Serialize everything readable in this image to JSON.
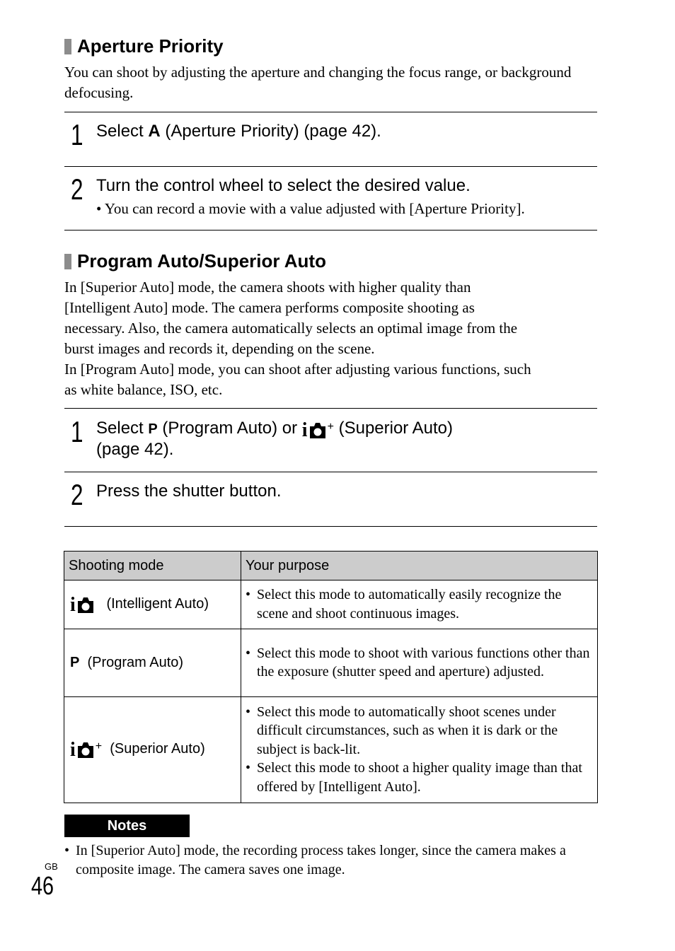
{
  "section1": {
    "title": "Aperture Priority",
    "intro": "You can shoot by adjusting the aperture and changing the focus range, or background defocusing.",
    "steps": [
      {
        "number": "1",
        "text_before": "Select ",
        "glyph": "A",
        "text_after": " (Aperture Priority) (page 42)."
      },
      {
        "number": "2",
        "text": "Turn the control wheel to select the desired value.",
        "sub": "• You can record a movie with a value adjusted with [Aperture Priority]."
      }
    ]
  },
  "section2": {
    "title": "Program Auto/Superior Auto",
    "intro_lines": [
      "In [Superior Auto] mode, the camera shoots with higher quality than",
      "[Intelligent Auto] mode. The camera performs composite shooting as",
      "necessary. Also, the camera automatically selects an optimal image from the",
      "burst images and records it, depending on the scene.",
      "In [Program Auto] mode, you can shoot after adjusting various functions, such",
      "as white balance, ISO, etc."
    ],
    "steps": [
      {
        "number": "1",
        "text_a": "Select ",
        "glyph": "P",
        "text_b": " (Program Auto) or ",
        "icon": "superior-auto-icon",
        "text_c": " (Superior Auto)",
        "text_d": "(page 42)."
      },
      {
        "number": "2",
        "text": "Press the shutter button."
      }
    ]
  },
  "table": {
    "headers": [
      "Shooting mode",
      "Your purpose"
    ],
    "rows": [
      {
        "icon": "intelligent-auto-icon",
        "mode": "(Intelligent Auto)",
        "purpose": [
          "Select this mode to automatically easily recognize the scene and shoot continuous images."
        ]
      },
      {
        "icon": "program-auto-icon",
        "glyph": "P",
        "mode": "(Program Auto)",
        "purpose": [
          "Select this mode to shoot with various functions other than the exposure (shutter speed and aperture) adjusted."
        ]
      },
      {
        "icon": "superior-auto-icon",
        "mode": "(Superior Auto)",
        "purpose": [
          "Select this mode to automatically shoot scenes under difficult circumstances, such as when it is dark or the subject is back-lit.",
          "Select this mode to shoot a higher quality image than that offered by [Intelligent Auto]."
        ]
      }
    ]
  },
  "notes": {
    "label": "Notes",
    "items": [
      "In [Superior Auto] mode, the recording process takes longer, since the camera makes a composite image. The camera saves one image."
    ]
  },
  "footer": {
    "region": "GB",
    "page_number": "46"
  },
  "icons": {
    "i_letter": "i",
    "plus": "+"
  }
}
